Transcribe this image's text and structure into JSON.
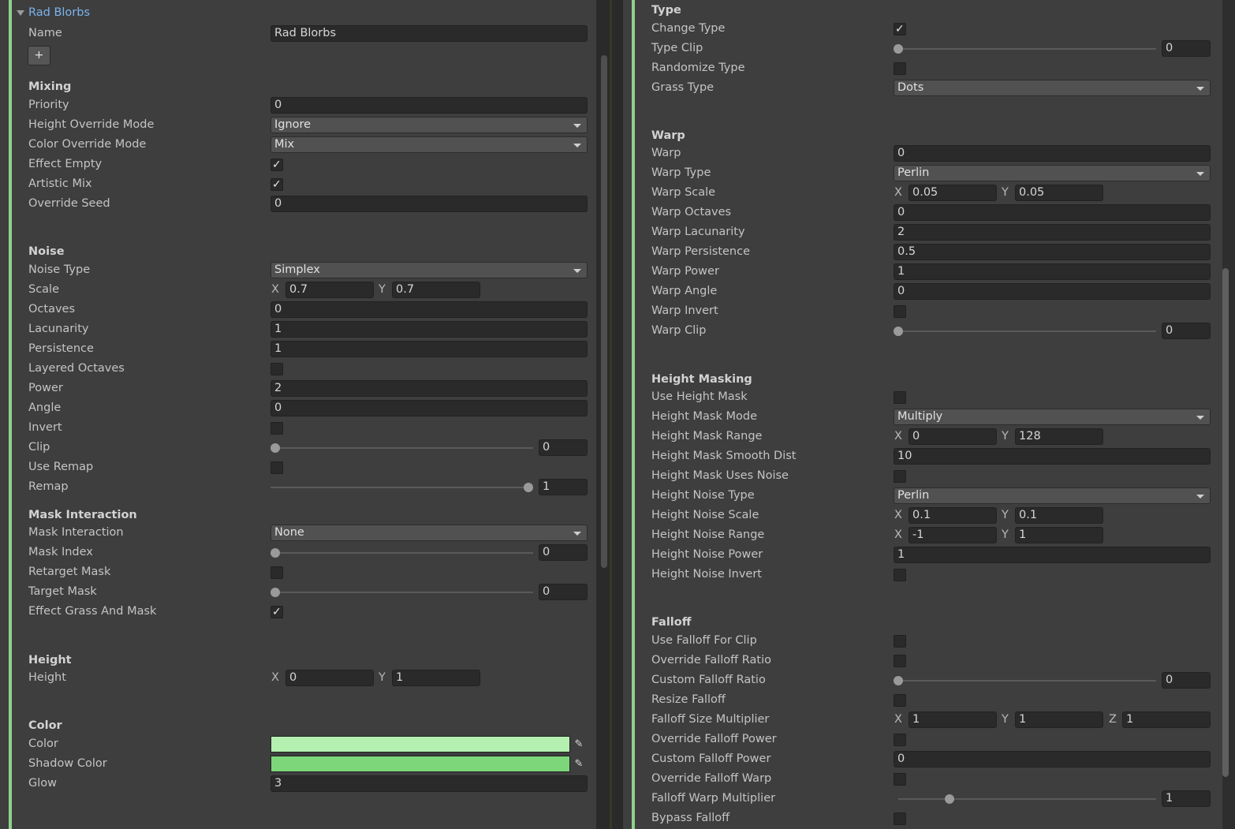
{
  "left": {
    "title": "Rad Blorbs",
    "name_label": "Name",
    "name_value": "Rad Blorbs",
    "add_button": "+",
    "mixing": {
      "header": "Mixing",
      "priority_label": "Priority",
      "priority_value": "0",
      "height_override_label": "Height Override Mode",
      "height_override_value": "Ignore",
      "color_override_label": "Color Override Mode",
      "color_override_value": "Mix",
      "effect_empty_label": "Effect Empty",
      "effect_empty_checked": true,
      "artistic_mix_label": "Artistic Mix",
      "artistic_mix_checked": true,
      "override_seed_label": "Override Seed",
      "override_seed_value": "0"
    },
    "noise": {
      "header": "Noise",
      "noise_type_label": "Noise Type",
      "noise_type_value": "Simplex",
      "scale_label": "Scale",
      "scale_x": "0.7",
      "scale_y": "0.7",
      "octaves_label": "Octaves",
      "octaves_value": "0",
      "lacunarity_label": "Lacunarity",
      "lacunarity_value": "1",
      "persistence_label": "Persistence",
      "persistence_value": "1",
      "layered_octaves_label": "Layered Octaves",
      "power_label": "Power",
      "power_value": "2",
      "angle_label": "Angle",
      "angle_value": "0",
      "invert_label": "Invert",
      "clip_label": "Clip",
      "clip_value": "0",
      "use_remap_label": "Use Remap",
      "remap_label": "Remap",
      "remap_value": "1"
    },
    "mask": {
      "header": "Mask Interaction",
      "mask_interaction_label": "Mask Interaction",
      "mask_interaction_value": "None",
      "mask_index_label": "Mask Index",
      "mask_index_value": "0",
      "retarget_label": "Retarget Mask",
      "target_mask_label": "Target Mask",
      "target_mask_value": "0",
      "effect_grass_label": "Effect Grass And Mask"
    },
    "height": {
      "header": "Height",
      "height_label": "Height",
      "height_x": "0",
      "height_y": "1"
    },
    "color": {
      "header": "Color",
      "color_label": "Color",
      "color_value": "#b4f0b0",
      "shadow_label": "Shadow Color",
      "shadow_value": "#7ed67a",
      "glow_label": "Glow",
      "glow_value": "3"
    }
  },
  "right": {
    "type": {
      "header": "Type",
      "change_type_label": "Change Type",
      "type_clip_label": "Type Clip",
      "type_clip_value": "0",
      "randomize_label": "Randomize Type",
      "grass_type_label": "Grass Type",
      "grass_type_value": "Dots"
    },
    "warp": {
      "header": "Warp",
      "warp_label": "Warp",
      "warp_value": "0",
      "warp_type_label": "Warp Type",
      "warp_type_value": "Perlin",
      "warp_scale_label": "Warp Scale",
      "warp_scale_x": "0.05",
      "warp_scale_y": "0.05",
      "warp_octaves_label": "Warp Octaves",
      "warp_octaves_value": "0",
      "warp_lacunarity_label": "Warp Lacunarity",
      "warp_lacunarity_value": "2",
      "warp_persistence_label": "Warp Persistence",
      "warp_persistence_value": "0.5",
      "warp_power_label": "Warp Power",
      "warp_power_value": "1",
      "warp_angle_label": "Warp Angle",
      "warp_angle_value": "0",
      "warp_invert_label": "Warp Invert",
      "warp_clip_label": "Warp Clip",
      "warp_clip_value": "0"
    },
    "hm": {
      "header": "Height Masking",
      "use_hm_label": "Use Height Mask",
      "hm_mode_label": "Height Mask Mode",
      "hm_mode_value": "Multiply",
      "hm_range_label": "Height Mask Range",
      "hm_range_x": "0",
      "hm_range_y": "128",
      "hm_smooth_label": "Height Mask Smooth Dist",
      "hm_smooth_value": "10",
      "hm_uses_noise_label": "Height Mask Uses Noise",
      "hn_type_label": "Height Noise Type",
      "hn_type_value": "Perlin",
      "hn_scale_label": "Height Noise Scale",
      "hn_scale_x": "0.1",
      "hn_scale_y": "0.1",
      "hn_range_label": "Height Noise Range",
      "hn_range_x": "-1",
      "hn_range_y": "1",
      "hn_power_label": "Height Noise Power",
      "hn_power_value": "1",
      "hn_invert_label": "Height Noise Invert"
    },
    "falloff": {
      "header": "Falloff",
      "use_clip_label": "Use Falloff For Clip",
      "override_ratio_label": "Override Falloff Ratio",
      "custom_ratio_label": "Custom Falloff Ratio",
      "custom_ratio_value": "0",
      "resize_label": "Resize Falloff",
      "size_mult_label": "Falloff Size Multiplier",
      "size_x": "1",
      "size_y": "1",
      "size_z": "1",
      "override_power_label": "Override Falloff Power",
      "custom_power_label": "Custom Falloff Power",
      "custom_power_value": "0",
      "override_warp_label": "Override Falloff Warp",
      "warp_mult_label": "Falloff Warp Multiplier",
      "warp_mult_value": "1",
      "bypass_label": "Bypass Falloff"
    }
  },
  "axes": {
    "x": "X",
    "y": "Y",
    "z": "Z"
  },
  "icons": {
    "picker": "eyedropper-icon",
    "check": "checkmark-icon",
    "foldout": "foldout-triangle-icon"
  }
}
